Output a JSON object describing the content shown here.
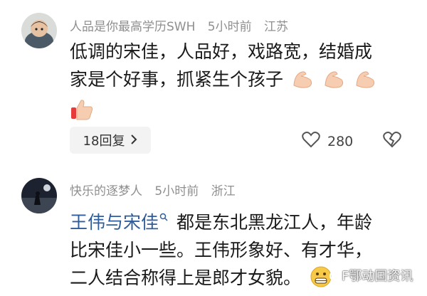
{
  "comments": [
    {
      "username": "人品是你最高学历SWH",
      "time": "5小时前",
      "location": "江苏",
      "lines": [
        "低调的宋佳，人品好，戏路宽，结婚成",
        "家是个好事，抓紧生个孩子"
      ],
      "emoji_icons": [
        "flexed-biceps-icon",
        "flexed-biceps-icon",
        "flexed-biceps-icon",
        "thumbs-up-icon"
      ],
      "reply_label": "18回复",
      "like_count": "280"
    },
    {
      "username": "快乐的逐梦人",
      "time": "5小时前",
      "location": "浙江",
      "mention": "王伟与宋佳",
      "lines": [
        "都是东北黑龙江人，年龄",
        "比宋佳小一些。王伟形象好、有才华，",
        "二人结合称得上是郎才女貌。"
      ]
    }
  ],
  "watermark": "F鄂动国资讯"
}
